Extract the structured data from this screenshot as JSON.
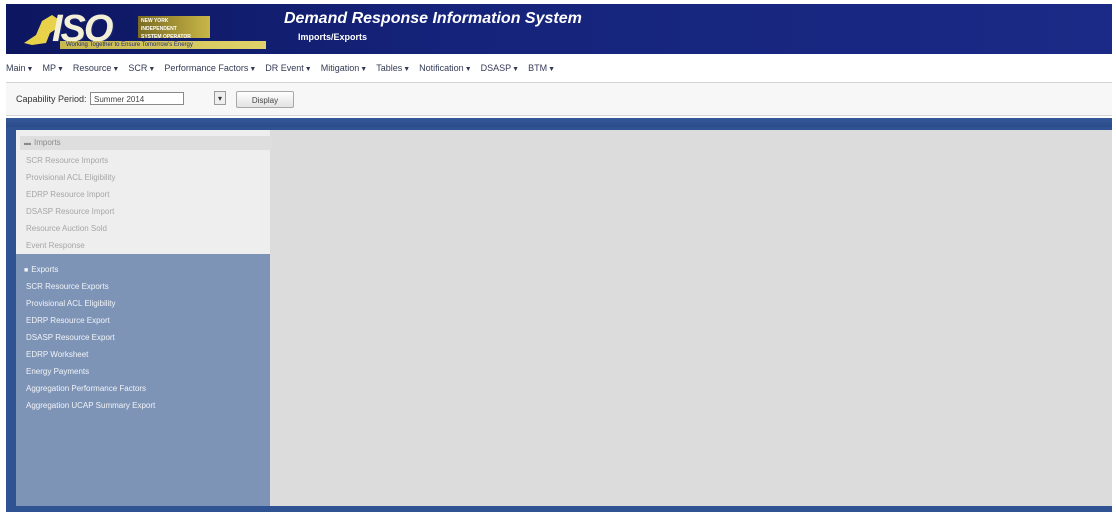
{
  "header": {
    "logo_text": "ISO",
    "logo_org_lines": [
      "NEW YORK",
      "INDEPENDENT",
      "SYSTEM OPERATOR"
    ],
    "logo_tagline": "Working Together to Ensure Tomorrow's Energy",
    "app_title": "Demand Response Information System",
    "page_subtitle": "Imports/Exports",
    "brand_color": "#15237a"
  },
  "menu": [
    "Main",
    "MP",
    "Resource",
    "SCR",
    "Performance Factors",
    "DR Event",
    "Mitigation",
    "Tables",
    "Notification",
    "DSASP",
    "BTM"
  ],
  "toolbar": {
    "capability_label": "Capability Period:",
    "capability_value": "Summer 2014",
    "display_label": "Display"
  },
  "sidebar": {
    "imports": {
      "header": "Imports",
      "items": [
        "SCR Resource Imports",
        "Provisional ACL Eligibility",
        "EDRP Resource Import",
        "DSASP Resource Import",
        "Resource Auction Sold",
        "Event Response"
      ]
    },
    "exports": {
      "header": "Exports",
      "items": [
        "SCR Resource Exports",
        "Provisional ACL Eligibility",
        "EDRP Resource Export",
        "DSASP Resource Export",
        "EDRP Worksheet",
        "Energy Payments",
        "Aggregation Performance Factors",
        "Aggregation UCAP Summary Export"
      ]
    }
  }
}
